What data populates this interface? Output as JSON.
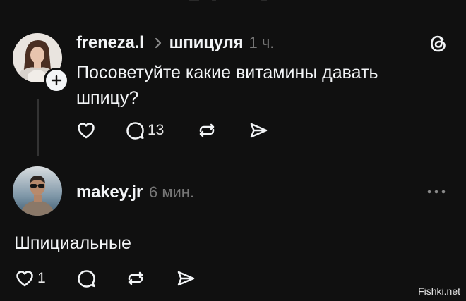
{
  "thread": {
    "app_icon": "threads-logo-icon",
    "post": {
      "username": "freneza.l",
      "separator_icon": "chevron-right-icon",
      "community": "шпицуля",
      "time": "1 ч.",
      "text_line1": "Посоветуйте какие витамины давать",
      "text_line2": "шпицу?",
      "replies": "13"
    },
    "reply": {
      "username": "makey.jr",
      "time": "6 мин.",
      "text": "Шпициальные",
      "likes": "1"
    }
  },
  "watermark": "Fishki.net",
  "colors": {
    "background": "#101010",
    "text": "#f3f5f7",
    "muted": "#777777"
  }
}
